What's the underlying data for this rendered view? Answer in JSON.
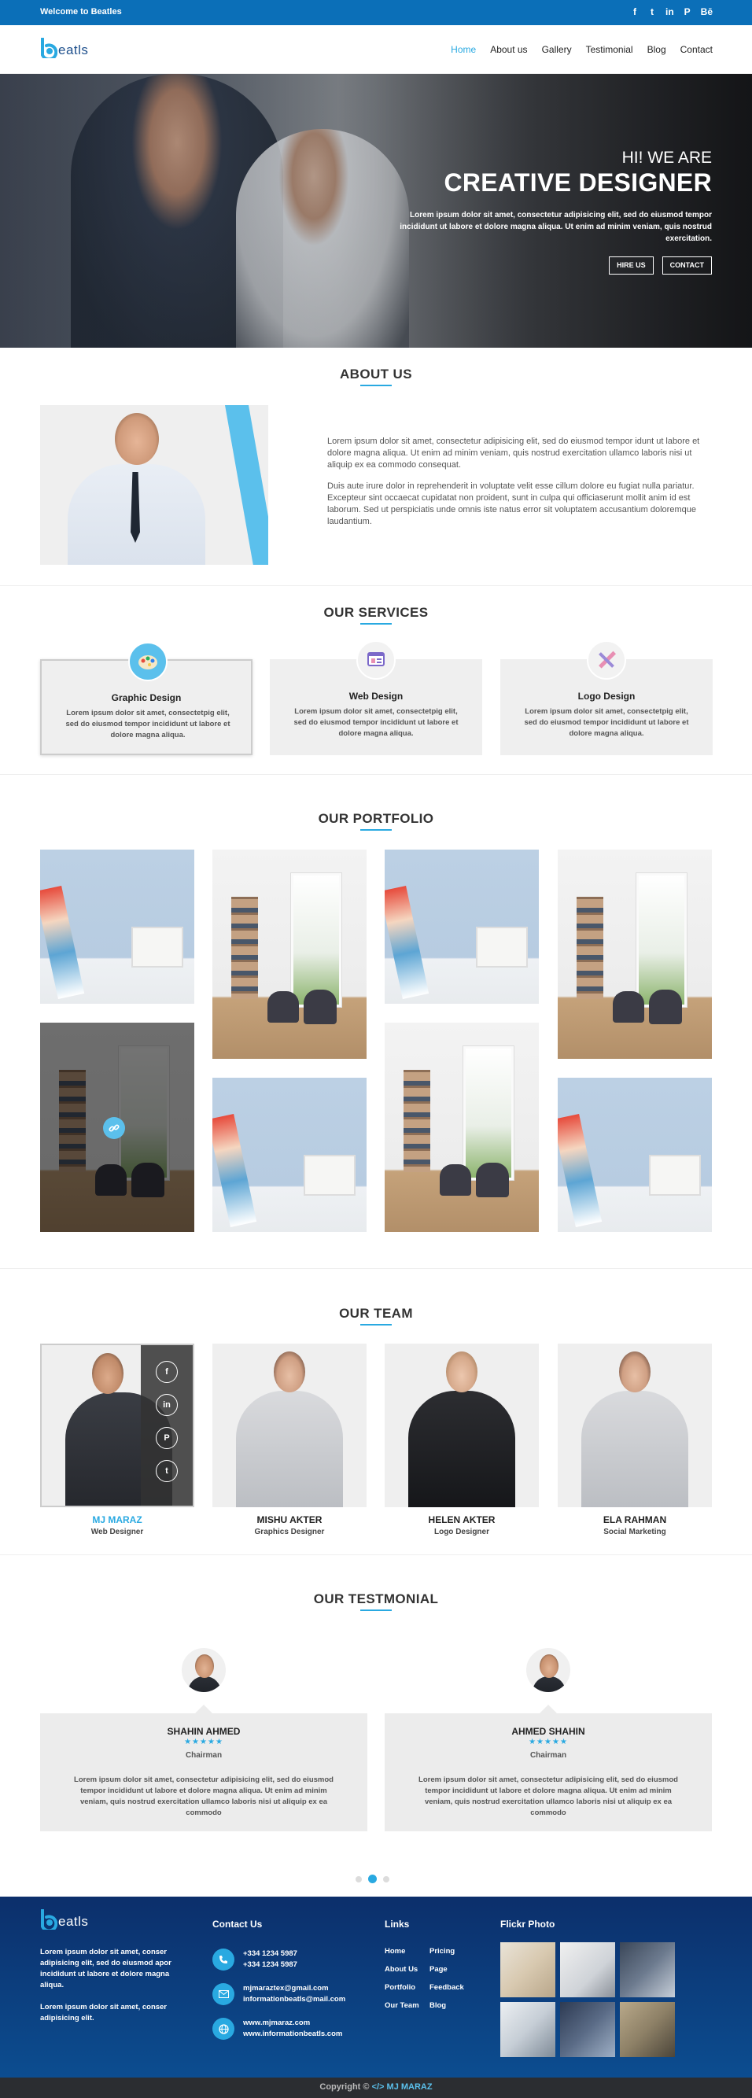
{
  "topbar": {
    "welcome": "Welcome to Beatles",
    "social_icons": [
      {
        "name": "facebook-icon",
        "glyph": "f"
      },
      {
        "name": "twitter-icon",
        "glyph": "t"
      },
      {
        "name": "linkedin-icon",
        "glyph": "in"
      },
      {
        "name": "pinterest-icon",
        "glyph": "P"
      },
      {
        "name": "behance-icon",
        "glyph": "Bē"
      }
    ]
  },
  "brand": {
    "text": "eatls",
    "accent_color": "#29a9e1",
    "primary_color": "#0b6fb8"
  },
  "nav": {
    "items": [
      {
        "label": "Home",
        "active": true
      },
      {
        "label": "About us",
        "active": false
      },
      {
        "label": "Gallery",
        "active": false
      },
      {
        "label": "Testimonial",
        "active": false
      },
      {
        "label": "Blog",
        "active": false
      },
      {
        "label": "Contact",
        "active": false
      }
    ]
  },
  "hero": {
    "kicker": "HI! WE ARE",
    "title": "CREATIVE DESIGNER",
    "description": "Lorem ipsum dolor sit amet, consectetur adipisicing elit, sed do eiusmod tempor incididunt ut labore et dolore magna aliqua. Ut enim ad minim veniam, quis nostrud exercitation.",
    "button_hire": "HIRE US",
    "button_contact": "CONTACT"
  },
  "about": {
    "title": "ABOUT US",
    "paragraph1": "Lorem ipsum dolor sit amet, consectetur adipisicing elit, sed do eiusmod tempor idunt ut labore et dolore magna aliqua. Ut enim ad minim veniam, quis nostrud exercitation ullamco laboris nisi ut aliquip ex ea commodo consequat.",
    "paragraph2": "Duis aute irure dolor in reprehenderit in voluptate velit esse cillum dolore eu fugiat nulla pariatur. Excepteur sint occaecat cupidatat non proident, sunt in culpa qui officiaserunt mollit anim id est laborum. Sed ut perspiciatis unde omnis iste natus error sit voluptatem accusantium doloremque laudantium."
  },
  "services": {
    "title": "OUR SERVICES",
    "items": [
      {
        "title": "Graphic Design",
        "icon": "palette-icon",
        "active": true,
        "text": "Lorem ipsum dolor sit amet, consectetpig elit, sed do eiusmod tempor incididunt ut labore et dolore magna aliqua."
      },
      {
        "title": "Web Design",
        "icon": "web-window-icon",
        "active": false,
        "text": "Lorem ipsum dolor sit amet, consectetpig elit, sed do eiusmod tempor incididunt ut labore et dolore magna aliqua."
      },
      {
        "title": "Logo Design",
        "icon": "pencil-ruler-icon",
        "active": false,
        "text": "Lorem ipsum dolor sit amet, consectetpig elit, sed do eiusmod tempor incididunt ut labore et dolore magna aliqua."
      }
    ]
  },
  "portfolio": {
    "title": "OUR PORTFOLIO",
    "hover_icon": "link-icon"
  },
  "team": {
    "title": "OUR TEAM",
    "members": [
      {
        "name": "MJ MARAZ",
        "role": "Web Designer",
        "active": true
      },
      {
        "name": "MISHU AKTER",
        "role": "Graphics Designer",
        "active": false
      },
      {
        "name": "HELEN AKTER",
        "role": "Logo Designer",
        "active": false
      },
      {
        "name": "ELA RAHMAN",
        "role": "Social Marketing",
        "active": false
      }
    ],
    "social_icons": [
      {
        "name": "facebook-icon",
        "glyph": "f"
      },
      {
        "name": "linkedin-icon",
        "glyph": "in"
      },
      {
        "name": "pinterest-icon",
        "glyph": "P"
      },
      {
        "name": "twitter-icon",
        "glyph": "t"
      }
    ]
  },
  "testimonial": {
    "title": "OUR TESTMONIAL",
    "items": [
      {
        "name": "SHAHIN AHMED",
        "role": "Chairman",
        "stars": "★★★★★",
        "quote": "Lorem ipsum dolor sit amet, consectetur adipisicing elit, sed do eiusmod tempor incididunt ut labore et dolore magna aliqua. Ut enim ad minim veniam, quis nostrud exercitation ullamco laboris nisi ut aliquip ex ea commodo"
      },
      {
        "name": "AHMED SHAHIN",
        "role": "Chairman",
        "stars": "★★★★★",
        "quote": "Lorem ipsum dolor sit amet, consectetur adipisicing elit, sed do eiusmod tempor incididunt ut labore et dolore magna aliqua. Ut enim ad minim veniam, quis nostrud exercitation ullamco laboris nisi ut aliquip ex ea commodo"
      }
    ],
    "active_dot": 1
  },
  "footer": {
    "about1": "Lorem ipsum dolor sit amet, conser adipisicing elit, sed do eiusmod apor incididunt ut labore et dolore magna aliqua.",
    "about2": "Lorem ipsum dolor sit amet, conser adipisicing elit.",
    "contact_title": "Contact Us",
    "phone1": "+334 1234 5987",
    "phone2": "+334 1234 5987",
    "email1": "mjmaraztex@gmail.com",
    "email2": "informationbeatls@mail.com",
    "web1": "www.mjmaraz.com",
    "web2": "www.informationbeatls.com",
    "links_title": "Links",
    "links_col1": [
      "Home",
      "About Us",
      "Portfolio",
      "Our Team"
    ],
    "links_col2": [
      "Pricing",
      "Page",
      "Feedback",
      "Blog"
    ],
    "flickr_title": "Flickr Photo"
  },
  "copyright": {
    "prefix": "Copyright ©",
    "code_glyph": "</>",
    "brand": "MJ MARAZ"
  }
}
